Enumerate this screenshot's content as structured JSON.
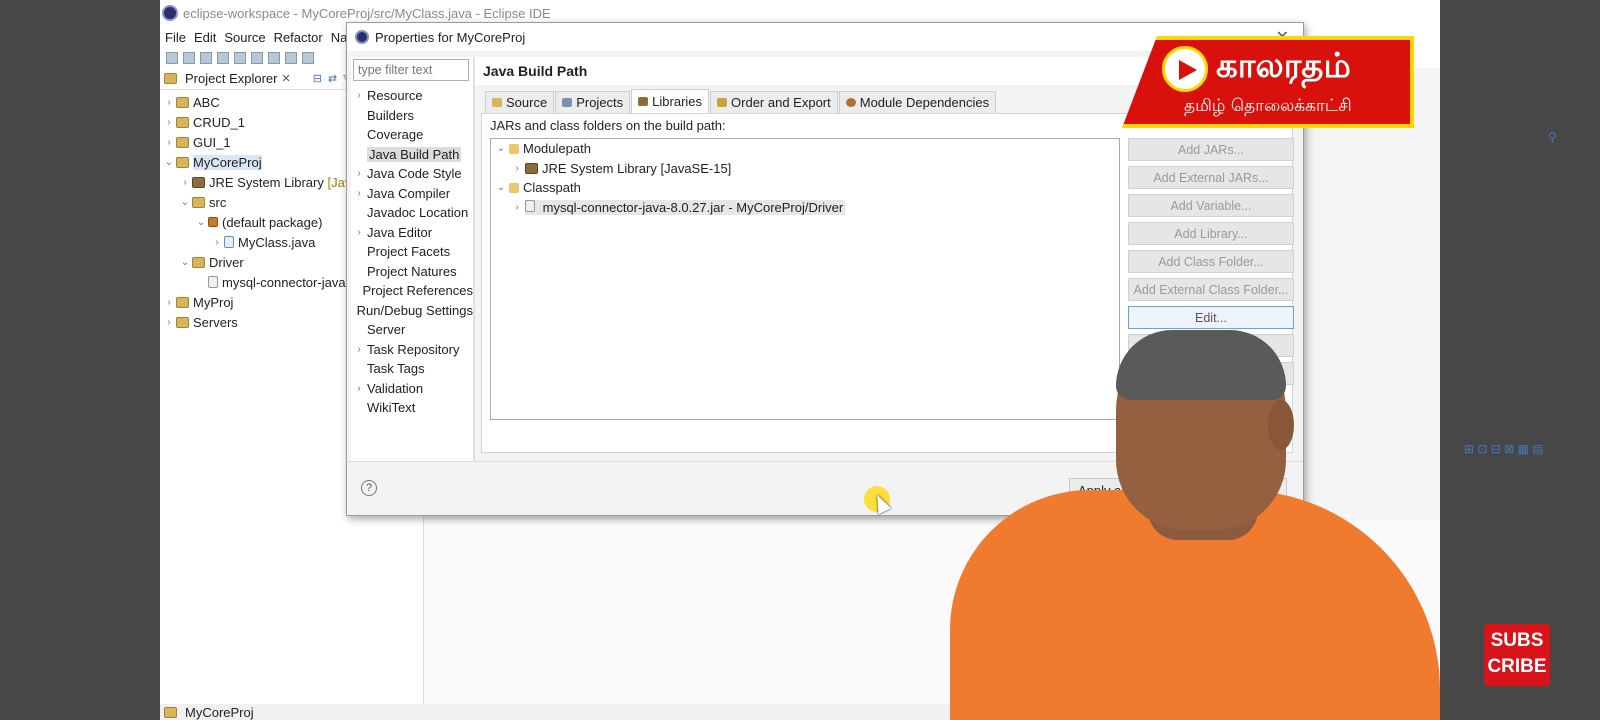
{
  "window": {
    "title": "eclipse-workspace - MyCoreProj/src/MyClass.java - Eclipse IDE",
    "menu": [
      "File",
      "Edit",
      "Source",
      "Refactor",
      "Navi"
    ]
  },
  "explorer": {
    "tab_label": "Project Explorer",
    "nodes": [
      {
        "label": "ABC",
        "suffix": ""
      },
      {
        "label": "CRUD_1",
        "suffix": ""
      },
      {
        "label": "GUI_1",
        "suffix": ""
      },
      {
        "label": "MyCoreProj",
        "suffix": ""
      },
      {
        "label": "JRE System Library",
        "suffix": "[JavaS"
      },
      {
        "label": "src",
        "suffix": ""
      },
      {
        "label": "(default package)",
        "suffix": ""
      },
      {
        "label": "MyClass.java",
        "suffix": ""
      },
      {
        "label": "Driver",
        "suffix": ""
      },
      {
        "label": "mysql-connector-java",
        "suffix": ""
      },
      {
        "label": "MyProj",
        "suffix": ""
      },
      {
        "label": "Servers",
        "suffix": ""
      }
    ]
  },
  "status": {
    "text": "MyCoreProj"
  },
  "dialog": {
    "title": "Properties for MyCoreProj",
    "filter_placeholder": "type filter text",
    "nav": [
      "Resource",
      "Builders",
      "Coverage",
      "Java Build Path",
      "Java Code Style",
      "Java Compiler",
      "Javadoc Location",
      "Java Editor",
      "Project Facets",
      "Project Natures",
      "Project References",
      "Run/Debug Settings",
      "Server",
      "Task Repository",
      "Task Tags",
      "Validation",
      "WikiText"
    ],
    "page_title": "Java Build Path",
    "tabs": [
      "Source",
      "Projects",
      "Libraries",
      "Order and Export",
      "Module Dependencies"
    ],
    "body_label": "JARs and class folders on the build path:",
    "tree": [
      "Modulepath",
      "JRE System Library [JavaSE-15]",
      "Classpath",
      "mysql-connector-java-8.0.27.jar - MyCoreProj/Driver"
    ],
    "buttons": [
      "Add JARs...",
      "Add External JARs...",
      "Add Variable...",
      "Add Library...",
      "Add Class Folder...",
      "Add External Class Folder...",
      "Edit..."
    ],
    "help": "?",
    "apply_label": "Apply and"
  },
  "overlay": {
    "logo_main": "காலரதம்",
    "logo_sub": "தமிழ் தொலைக்காட்சி",
    "subscribe_line1": "SUBS",
    "subscribe_line2": "CRIBE"
  },
  "colors": {
    "logo_red": "#d8110d",
    "logo_gold": "#ffd700",
    "subscribe_red": "#d9131a",
    "shirt_orange": "#f07a2e"
  }
}
